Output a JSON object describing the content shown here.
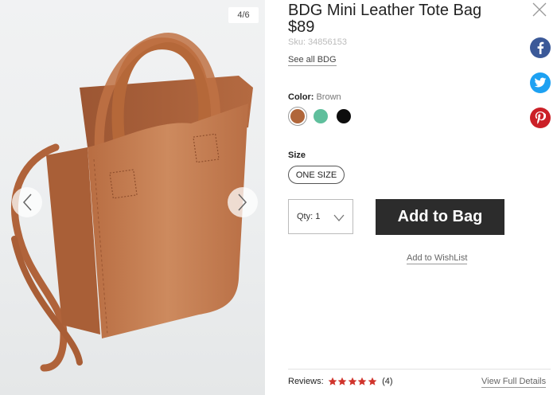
{
  "product": {
    "title": "BDG Mini Leather Tote Bag",
    "price": "$89",
    "sku_label": "Sku:",
    "sku_value": "34856153",
    "see_all": "See all BDG"
  },
  "gallery": {
    "counter": "4/6",
    "prev_icon": "chevron-left-icon",
    "next_icon": "chevron-right-icon"
  },
  "color": {
    "label": "Color:",
    "selected": "Brown",
    "swatches": [
      {
        "name": "brown",
        "hex": "#b0663a"
      },
      {
        "name": "green",
        "hex": "#5fbf9c"
      },
      {
        "name": "black",
        "hex": "#0d0d0d"
      }
    ]
  },
  "size": {
    "label": "Size",
    "option": "ONE SIZE"
  },
  "quantity": {
    "label": "Qty: 1"
  },
  "actions": {
    "add_to_bag": "Add to Bag",
    "wishlist": "Add to WishList"
  },
  "reviews": {
    "label": "Reviews:",
    "rating": 5,
    "count": "(4)",
    "full_details": "View Full Details"
  },
  "social": [
    "facebook-icon",
    "twitter-icon",
    "pinterest-icon"
  ],
  "colors": {
    "button_bg": "#2c2c2c",
    "star": "#d0342c",
    "facebook": "#3b5998",
    "twitter": "#1da1f2",
    "pinterest": "#cb2027"
  }
}
